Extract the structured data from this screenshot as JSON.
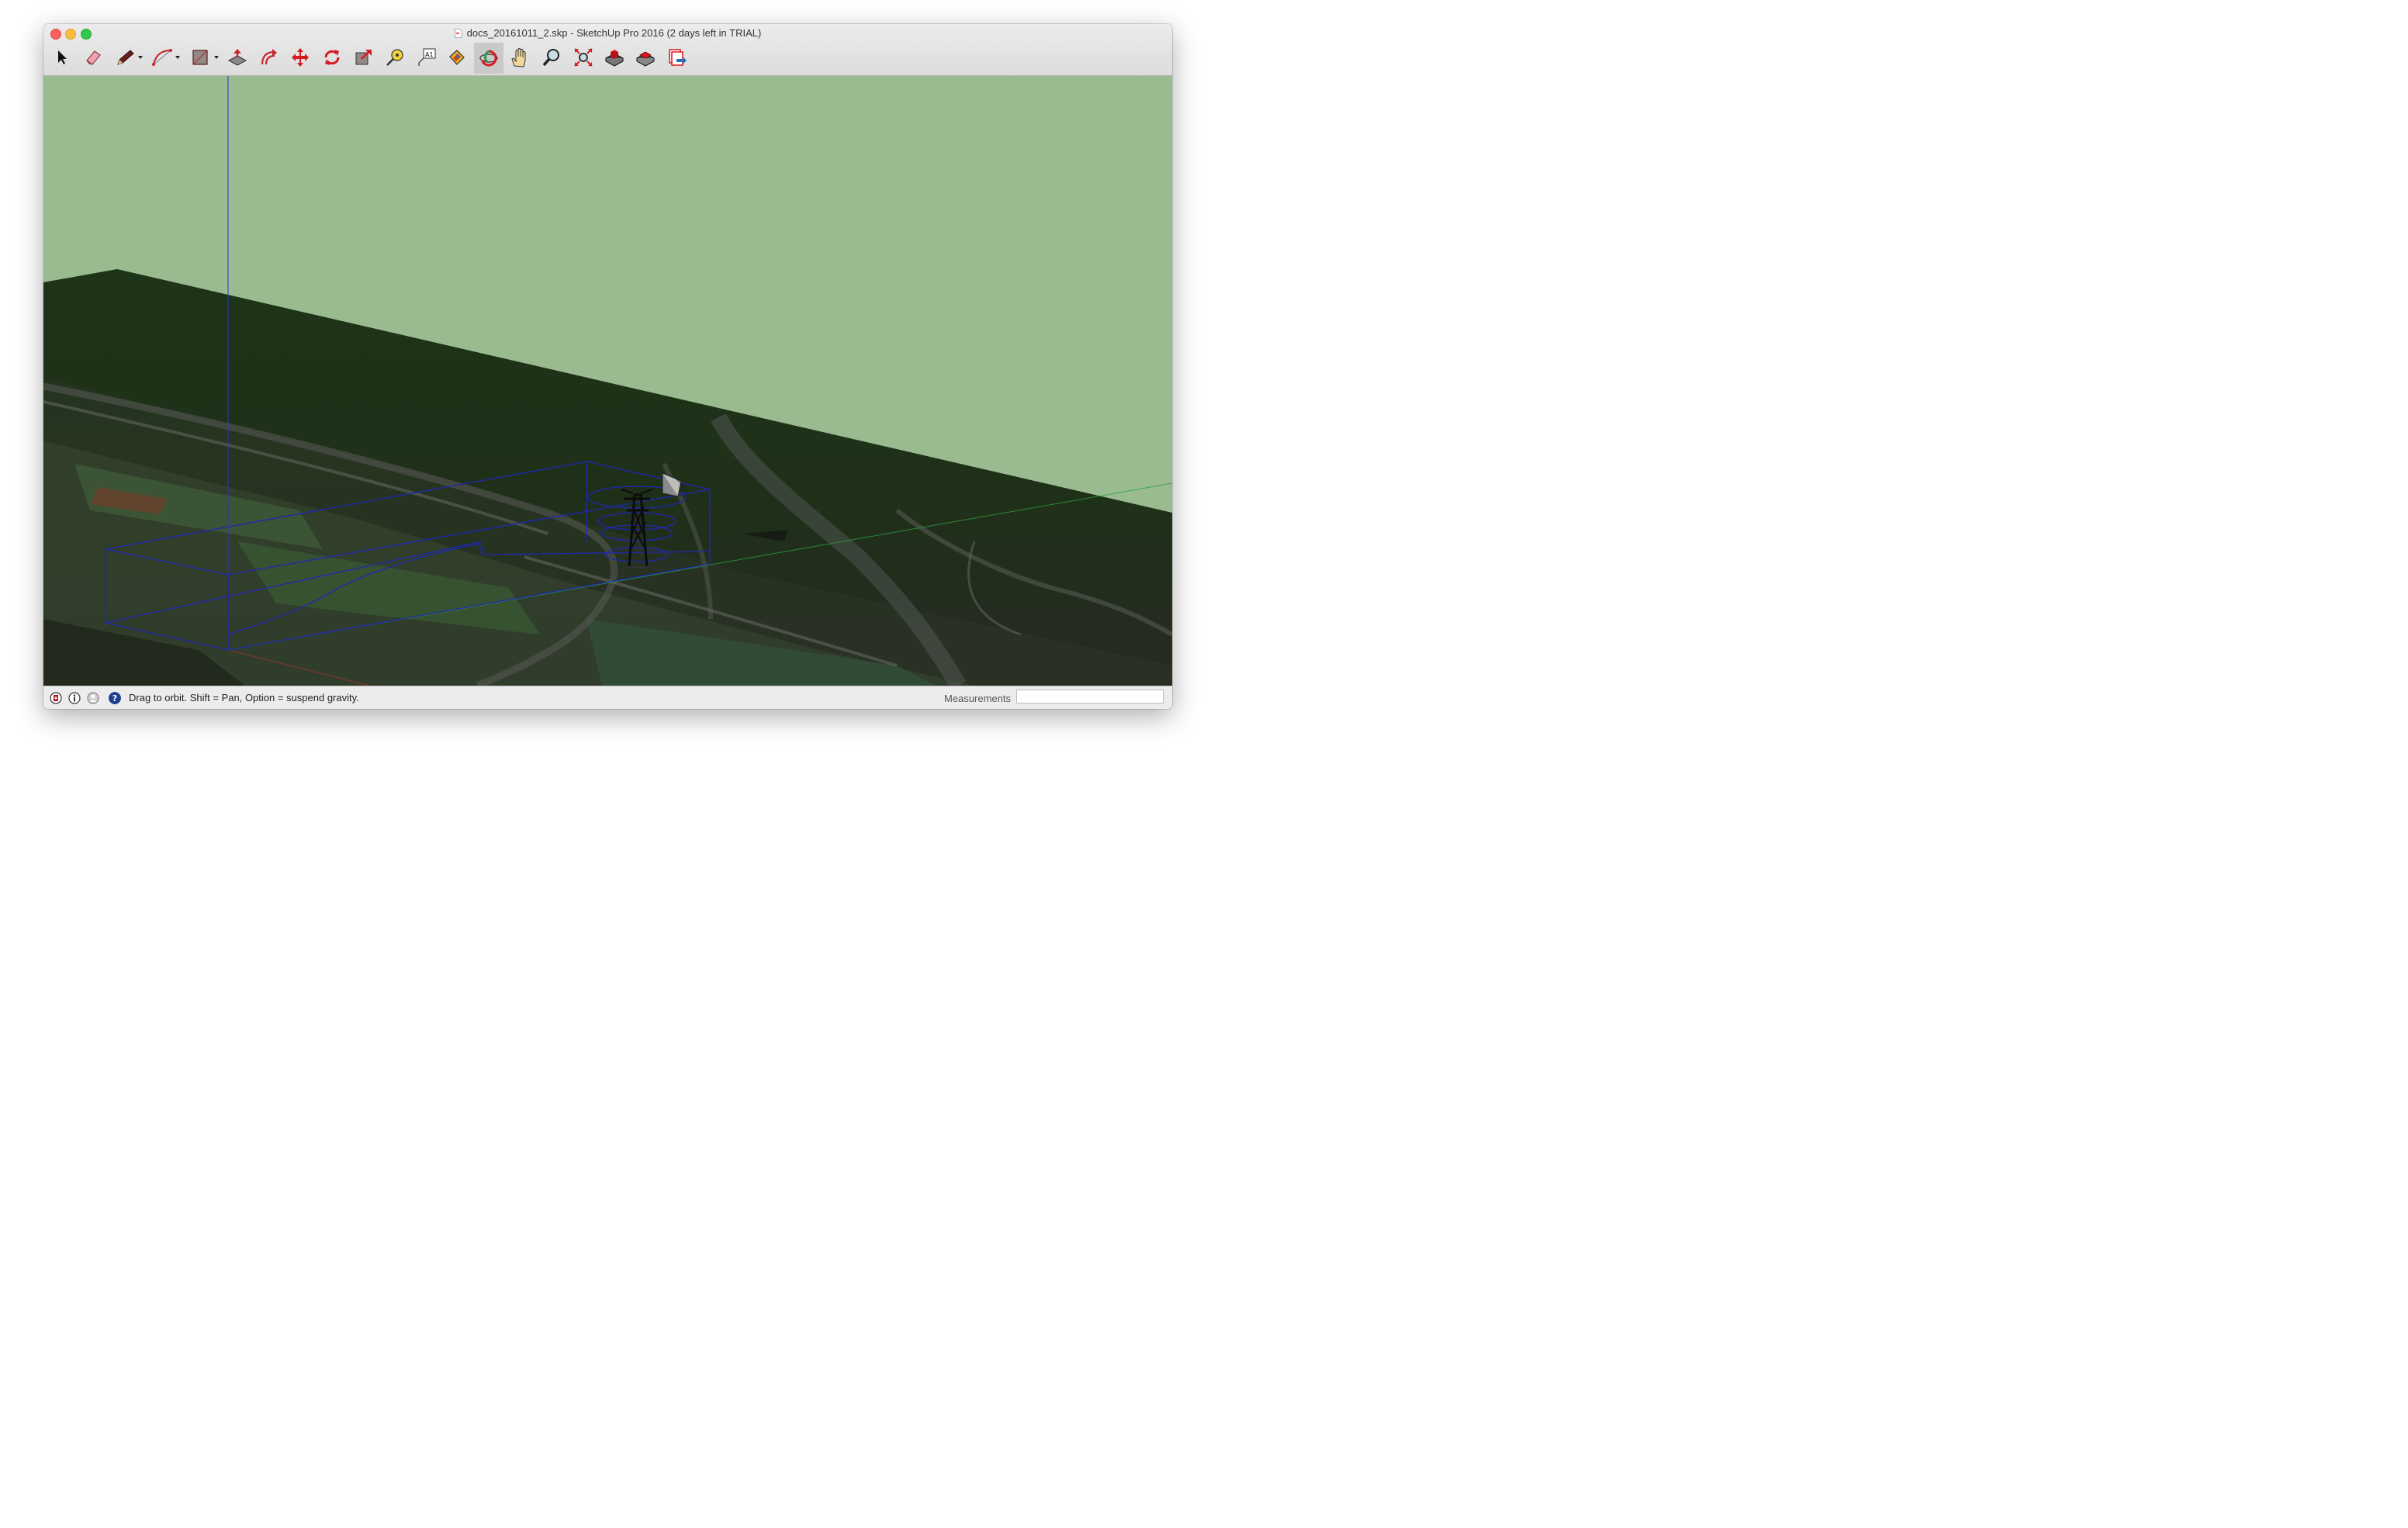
{
  "window": {
    "title": "docs_20161011_2.skp - SketchUp Pro 2016 (2 days left in TRIAL)"
  },
  "toolbar": {
    "tools": [
      {
        "name": "select-tool-button",
        "icon": "arrow-pointer-icon",
        "label": "Select",
        "active": false
      },
      {
        "name": "eraser-tool-button",
        "icon": "eraser-icon",
        "label": "Eraser",
        "active": false
      },
      {
        "name": "line-tool-button",
        "icon": "pencil-icon",
        "label": "Line",
        "active": false,
        "dropdown": true
      },
      {
        "name": "arc-tool-button",
        "icon": "arc-icon",
        "label": "Arc",
        "active": false,
        "dropdown": true
      },
      {
        "name": "shape-tool-button",
        "icon": "rectangle-icon",
        "label": "Rectangle",
        "active": false,
        "dropdown": true
      },
      {
        "name": "push-pull-tool-button",
        "icon": "push-pull-icon",
        "label": "Push/Pull",
        "active": false
      },
      {
        "name": "offset-tool-button",
        "icon": "offset-icon",
        "label": "Offset",
        "active": false
      },
      {
        "name": "move-tool-button",
        "icon": "move-arrows-icon",
        "label": "Move",
        "active": false
      },
      {
        "name": "rotate-tool-button",
        "icon": "rotate-icon",
        "label": "Rotate",
        "active": false
      },
      {
        "name": "scale-tool-button",
        "icon": "scale-icon",
        "label": "Scale",
        "active": false
      },
      {
        "name": "tape-measure-tool-button",
        "icon": "tape-measure-icon",
        "label": "Tape Measure",
        "active": false
      },
      {
        "name": "text-tool-button",
        "icon": "text-label-icon",
        "label": "Text",
        "active": false
      },
      {
        "name": "paint-bucket-tool-button",
        "icon": "paint-bucket-icon",
        "label": "Paint Bucket",
        "active": false
      },
      {
        "name": "orbit-tool-button",
        "icon": "orbit-icon",
        "label": "Orbit",
        "active": true
      },
      {
        "name": "pan-tool-button",
        "icon": "hand-icon",
        "label": "Pan",
        "active": false
      },
      {
        "name": "zoom-tool-button",
        "icon": "magnifier-icon",
        "label": "Zoom",
        "active": false
      },
      {
        "name": "zoom-extents-tool-button",
        "icon": "zoom-extents-icon",
        "label": "Zoom Extents",
        "active": false
      },
      {
        "name": "3d-warehouse-button",
        "icon": "warehouse-icon",
        "label": "3D Warehouse",
        "active": false
      },
      {
        "name": "extension-warehouse-button",
        "icon": "extension-warehouse-icon",
        "label": "Extension Warehouse",
        "active": false
      },
      {
        "name": "layout-send-button",
        "icon": "send-to-layout-icon",
        "label": "Send to LayOut",
        "active": false
      }
    ]
  },
  "viewport": {
    "sky_color": "#99bb8f",
    "ground_color": "#1e3119"
  },
  "statusbar": {
    "icons": [
      "geo-location-icon",
      "credits-icon",
      "user-icon"
    ],
    "help_icon": "question-icon",
    "message": "Drag to orbit. Shift = Pan, Option = suspend gravity.",
    "measurements_label": "Measurements",
    "measurements_value": ""
  }
}
